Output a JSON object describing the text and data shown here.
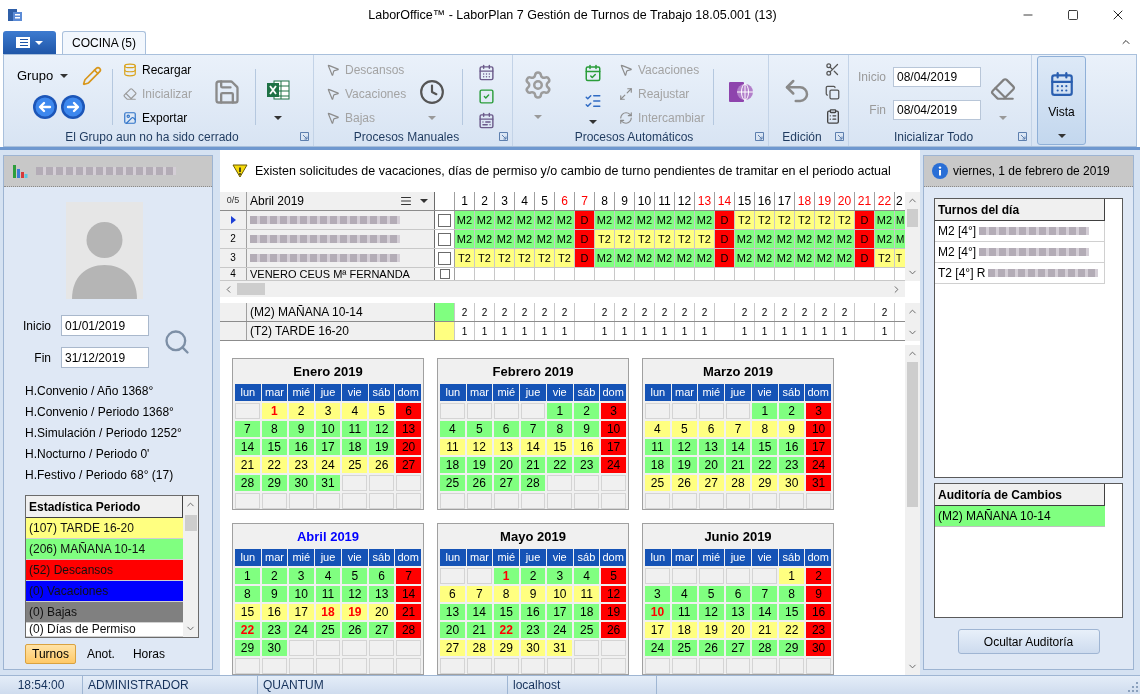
{
  "window": {
    "title": "LaborOffice™ - LaborPlan 7 Gestión de Turnos de Trabajo 18.05.001 (13)"
  },
  "tabs": [
    {
      "label": "COCINA (5)",
      "selected": true
    }
  ],
  "ribbon": {
    "grupo": {
      "label": "Grupo",
      "buttons": [
        {
          "label": "Recargar",
          "disabled": false
        },
        {
          "label": "Inicializar",
          "disabled": true
        },
        {
          "label": "Exportar",
          "disabled": false
        }
      ],
      "caption": "El Grupo aun no ha sido cerrado"
    },
    "manual": {
      "buttons": [
        {
          "label": "Descansos",
          "disabled": true
        },
        {
          "label": "Vacaciones",
          "disabled": true
        },
        {
          "label": "Bajas",
          "disabled": true
        }
      ],
      "caption": "Procesos Manuales"
    },
    "automatic": {
      "buttons": [
        {
          "label": "Vacaciones",
          "disabled": true
        },
        {
          "label": "Reajustar",
          "disabled": true
        },
        {
          "label": "Intercambiar",
          "disabled": true
        }
      ],
      "caption": "Procesos Automáticos"
    },
    "edit": {
      "caption": "Edición"
    },
    "reset_all": {
      "disabled": true,
      "fields": [
        {
          "label": "Inicio",
          "value": "08/04/2019"
        },
        {
          "label": "Fin",
          "value": "08/04/2019"
        }
      ],
      "caption": "Inicializar Todo"
    },
    "view": {
      "label": "Vista",
      "selected": true
    }
  },
  "employee_panel": {
    "dates": [
      {
        "label": "Inicio",
        "value": "01/01/2019"
      },
      {
        "label": "Fin",
        "value": "31/12/2019"
      }
    ],
    "totals": [
      "H.Convenio / Año 1368°",
      "H.Convenio / Periodo 1368°",
      "H.Simulación / Periodo 1252°",
      "H.Nocturno / Periodo 0'",
      "H.Festivo / Periodo 68° (17)"
    ],
    "statistics": {
      "header": "Estadística Periodo",
      "rows": [
        {
          "label": "(107) TARDE 16-20",
          "color": "#ffff80"
        },
        {
          "label": "(206) MAÑANA 10-14",
          "color": "#80ff80"
        },
        {
          "label": "(52) Descansos",
          "color": "#ff0000"
        },
        {
          "label": "(0) Vacaciones",
          "color": "#0000ff"
        },
        {
          "label": "(0) Bajas",
          "color": "#808080"
        },
        {
          "label": "(0) Días de Permiso",
          "color": "#ffffff"
        }
      ]
    },
    "tabs": [
      {
        "label": "Turnos",
        "selected": true
      },
      {
        "label": "Anot.",
        "selected": false
      },
      {
        "label": "Horas",
        "selected": false
      }
    ]
  },
  "notice": "Existen solicitudes de vacaciones, días de permiso y/o cambio de turno pendientes de tramitar en el periodo actual",
  "grid": {
    "counter": "0/5",
    "month": "Abril 2019",
    "days": [
      {
        "label": "1",
        "holiday": false
      },
      {
        "label": "2",
        "holiday": false
      },
      {
        "label": "3",
        "holiday": false
      },
      {
        "label": "4",
        "holiday": false
      },
      {
        "label": "5",
        "holiday": false
      },
      {
        "label": "6",
        "holiday": true
      },
      {
        "label": "7",
        "holiday": true
      },
      {
        "label": "8",
        "holiday": false
      },
      {
        "label": "9",
        "holiday": false
      },
      {
        "label": "10",
        "holiday": false
      },
      {
        "label": "11",
        "holiday": false
      },
      {
        "label": "12",
        "holiday": false
      },
      {
        "label": "13",
        "holiday": true
      },
      {
        "label": "14",
        "holiday": true
      },
      {
        "label": "15",
        "holiday": false
      },
      {
        "label": "16",
        "holiday": false
      },
      {
        "label": "17",
        "holiday": false
      },
      {
        "label": "18",
        "holiday": true
      },
      {
        "label": "19",
        "holiday": true
      },
      {
        "label": "20",
        "holiday": true
      },
      {
        "label": "21",
        "holiday": true
      },
      {
        "label": "22",
        "holiday": true
      },
      {
        "label": "2",
        "holiday": false
      }
    ],
    "rows": [
      {
        "current": true,
        "redacted": true,
        "checked": false,
        "shifts": [
          {
            "code": "M2",
            "kind": "morning"
          },
          {
            "code": "M2",
            "kind": "morning"
          },
          {
            "code": "M2",
            "kind": "morning"
          },
          {
            "code": "M2",
            "kind": "morning"
          },
          {
            "code": "M2",
            "kind": "morning"
          },
          {
            "code": "M2",
            "kind": "morning"
          },
          {
            "code": "D",
            "kind": "rest"
          },
          {
            "code": "M2",
            "kind": "morning"
          },
          {
            "code": "M2",
            "kind": "morning"
          },
          {
            "code": "M2",
            "kind": "morning"
          },
          {
            "code": "M2",
            "kind": "morning"
          },
          {
            "code": "M2",
            "kind": "morning"
          },
          {
            "code": "M2",
            "kind": "morning"
          },
          {
            "code": "D",
            "kind": "rest"
          },
          {
            "code": "T2",
            "kind": "afternoon"
          },
          {
            "code": "T2",
            "kind": "afternoon"
          },
          {
            "code": "T2",
            "kind": "afternoon"
          },
          {
            "code": "T2",
            "kind": "afternoon"
          },
          {
            "code": "T2",
            "kind": "afternoon"
          },
          {
            "code": "T2",
            "kind": "afternoon"
          },
          {
            "code": "D",
            "kind": "rest"
          },
          {
            "code": "M2",
            "kind": "morning"
          },
          {
            "code": "M",
            "kind": "morning"
          }
        ]
      },
      {
        "current": false,
        "number": "2",
        "redacted": true,
        "checked": false,
        "shifts": [
          {
            "code": "M2",
            "kind": "morning"
          },
          {
            "code": "M2",
            "kind": "morning"
          },
          {
            "code": "M2",
            "kind": "morning"
          },
          {
            "code": "M2",
            "kind": "morning"
          },
          {
            "code": "M2",
            "kind": "morning"
          },
          {
            "code": "M2",
            "kind": "morning"
          },
          {
            "code": "D",
            "kind": "rest"
          },
          {
            "code": "T2",
            "kind": "afternoon"
          },
          {
            "code": "T2",
            "kind": "afternoon"
          },
          {
            "code": "T2",
            "kind": "afternoon"
          },
          {
            "code": "T2",
            "kind": "afternoon"
          },
          {
            "code": "T2",
            "kind": "afternoon"
          },
          {
            "code": "T2",
            "kind": "afternoon"
          },
          {
            "code": "D",
            "kind": "rest"
          },
          {
            "code": "M2",
            "kind": "morning"
          },
          {
            "code": "M2",
            "kind": "morning"
          },
          {
            "code": "M2",
            "kind": "morning"
          },
          {
            "code": "M2",
            "kind": "morning"
          },
          {
            "code": "M2",
            "kind": "morning"
          },
          {
            "code": "M2",
            "kind": "morning"
          },
          {
            "code": "D",
            "kind": "rest"
          },
          {
            "code": "M2",
            "kind": "morning"
          },
          {
            "code": "M",
            "kind": "morning"
          }
        ]
      },
      {
        "current": false,
        "number": "3",
        "redacted": true,
        "checked": false,
        "shifts": [
          {
            "code": "T2",
            "kind": "afternoon"
          },
          {
            "code": "T2",
            "kind": "afternoon"
          },
          {
            "code": "T2",
            "kind": "afternoon"
          },
          {
            "code": "T2",
            "kind": "afternoon"
          },
          {
            "code": "T2",
            "kind": "afternoon"
          },
          {
            "code": "T2",
            "kind": "afternoon"
          },
          {
            "code": "D",
            "kind": "rest"
          },
          {
            "code": "M2",
            "kind": "morning"
          },
          {
            "code": "M2",
            "kind": "morning"
          },
          {
            "code": "M2",
            "kind": "morning"
          },
          {
            "code": "M2",
            "kind": "morning"
          },
          {
            "code": "M2",
            "kind": "morning"
          },
          {
            "code": "M2",
            "kind": "morning"
          },
          {
            "code": "D",
            "kind": "rest"
          },
          {
            "code": "M2",
            "kind": "morning"
          },
          {
            "code": "M2",
            "kind": "morning"
          },
          {
            "code": "M2",
            "kind": "morning"
          },
          {
            "code": "M2",
            "kind": "morning"
          },
          {
            "code": "M2",
            "kind": "morning"
          },
          {
            "code": "M2",
            "kind": "morning"
          },
          {
            "code": "D",
            "kind": "rest"
          },
          {
            "code": "T2",
            "kind": "afternoon"
          },
          {
            "code": "T",
            "kind": "afternoon"
          }
        ]
      },
      {
        "current": false,
        "number": "4",
        "redacted": false,
        "name": "VENERO CEUS Mª FERNANDA",
        "checked": false,
        "shifts": []
      }
    ]
  },
  "shift_totals": [
    {
      "label": "(M2) MAÑANA 10-14",
      "color": "#80ff80",
      "counts": [
        {
          "kind": "count",
          "value": "2"
        },
        {
          "kind": "count",
          "value": "2"
        },
        {
          "kind": "count",
          "value": "2"
        },
        {
          "kind": "count",
          "value": "2"
        },
        {
          "kind": "count",
          "value": "2"
        },
        {
          "kind": "count",
          "value": "2"
        },
        {
          "kind": "empty"
        },
        {
          "kind": "count",
          "value": "2"
        },
        {
          "kind": "count",
          "value": "2"
        },
        {
          "kind": "count",
          "value": "2"
        },
        {
          "kind": "count",
          "value": "2"
        },
        {
          "kind": "count",
          "value": "2"
        },
        {
          "kind": "count",
          "value": "2"
        },
        {
          "kind": "empty"
        },
        {
          "kind": "count",
          "value": "2"
        },
        {
          "kind": "count",
          "value": "2"
        },
        {
          "kind": "count",
          "value": "2"
        },
        {
          "kind": "count",
          "value": "2"
        },
        {
          "kind": "count",
          "value": "2"
        },
        {
          "kind": "count",
          "value": "2"
        },
        {
          "kind": "empty"
        },
        {
          "kind": "count",
          "value": "2"
        }
      ]
    },
    {
      "label": "(T2) TARDE 16-20",
      "color": "#ffff80",
      "counts": [
        {
          "kind": "count",
          "value": "1"
        },
        {
          "kind": "count",
          "value": "1"
        },
        {
          "kind": "count",
          "value": "1"
        },
        {
          "kind": "count",
          "value": "1"
        },
        {
          "kind": "count",
          "value": "1"
        },
        {
          "kind": "count",
          "value": "1"
        },
        {
          "kind": "empty"
        },
        {
          "kind": "count",
          "value": "1"
        },
        {
          "kind": "count",
          "value": "1"
        },
        {
          "kind": "count",
          "value": "1"
        },
        {
          "kind": "count",
          "value": "1"
        },
        {
          "kind": "count",
          "value": "1"
        },
        {
          "kind": "count",
          "value": "1"
        },
        {
          "kind": "empty"
        },
        {
          "kind": "count",
          "value": "1"
        },
        {
          "kind": "count",
          "value": "1"
        },
        {
          "kind": "count",
          "value": "1"
        },
        {
          "kind": "count",
          "value": "1"
        },
        {
          "kind": "count",
          "value": "1"
        },
        {
          "kind": "count",
          "value": "1"
        },
        {
          "kind": "empty"
        },
        {
          "kind": "count",
          "value": "1"
        }
      ]
    }
  ],
  "calendars": [
    {
      "title": "Enero 2019",
      "selected": false,
      "weekdays": [
        "lun",
        "mar",
        "mié",
        "jue",
        "vie",
        "sáb",
        "dom"
      ],
      "weeks": [
        [
          {
            "kind": "blank"
          },
          {
            "day": "1",
            "kind": "afternoon",
            "holiday": true
          },
          {
            "day": "2",
            "kind": "afternoon",
            "holiday": false
          },
          {
            "day": "3",
            "kind": "afternoon",
            "holiday": false
          },
          {
            "day": "4",
            "kind": "afternoon",
            "holiday": false
          },
          {
            "day": "5",
            "kind": "afternoon",
            "holiday": false
          },
          {
            "day": "6",
            "kind": "rest",
            "holiday": false
          }
        ],
        [
          {
            "day": "7",
            "kind": "morning",
            "holiday": false
          },
          {
            "day": "8",
            "kind": "morning",
            "holiday": false
          },
          {
            "day": "9",
            "kind": "morning",
            "holiday": false
          },
          {
            "day": "10",
            "kind": "morning",
            "holiday": false
          },
          {
            "day": "11",
            "kind": "morning",
            "holiday": false
          },
          {
            "day": "12",
            "kind": "morning",
            "holiday": false
          },
          {
            "day": "13",
            "kind": "rest",
            "holiday": false
          }
        ],
        [
          {
            "day": "14",
            "kind": "morning",
            "holiday": false
          },
          {
            "day": "15",
            "kind": "morning",
            "holiday": false
          },
          {
            "day": "16",
            "kind": "morning",
            "holiday": false
          },
          {
            "day": "17",
            "kind": "morning",
            "holiday": false
          },
          {
            "day": "18",
            "kind": "morning",
            "holiday": false
          },
          {
            "day": "19",
            "kind": "morning",
            "holiday": false
          },
          {
            "day": "20",
            "kind": "rest",
            "holiday": false
          }
        ],
        [
          {
            "day": "21",
            "kind": "afternoon",
            "holiday": false
          },
          {
            "day": "22",
            "kind": "afternoon",
            "holiday": false
          },
          {
            "day": "23",
            "kind": "afternoon",
            "holiday": false
          },
          {
            "day": "24",
            "kind": "afternoon",
            "holiday": false
          },
          {
            "day": "25",
            "kind": "afternoon",
            "holiday": false
          },
          {
            "day": "26",
            "kind": "afternoon",
            "holiday": false
          },
          {
            "day": "27",
            "kind": "rest",
            "holiday": false
          }
        ],
        [
          {
            "day": "28",
            "kind": "morning",
            "holiday": false
          },
          {
            "day": "29",
            "kind": "morning",
            "holiday": false
          },
          {
            "day": "30",
            "kind": "morning",
            "holiday": false
          },
          {
            "day": "31",
            "kind": "morning",
            "holiday": false
          }
        ]
      ]
    },
    {
      "title": "Febrero 2019",
      "selected": false,
      "weekdays": [
        "lun",
        "mar",
        "mié",
        "jue",
        "vie",
        "sáb",
        "dom"
      ],
      "weeks": [
        [
          {
            "kind": "blank"
          },
          {
            "kind": "blank"
          },
          {
            "kind": "blank"
          },
          {
            "kind": "blank"
          },
          {
            "day": "1",
            "kind": "morning",
            "holiday": false
          },
          {
            "day": "2",
            "kind": "morning",
            "holiday": false
          },
          {
            "day": "3",
            "kind": "rest",
            "holiday": false
          }
        ],
        [
          {
            "day": "4",
            "kind": "morning",
            "holiday": false
          },
          {
            "day": "5",
            "kind": "morning",
            "holiday": false
          },
          {
            "day": "6",
            "kind": "morning",
            "holiday": false
          },
          {
            "day": "7",
            "kind": "morning",
            "holiday": false
          },
          {
            "day": "8",
            "kind": "morning",
            "holiday": false
          },
          {
            "day": "9",
            "kind": "morning",
            "holiday": false
          },
          {
            "day": "10",
            "kind": "rest",
            "holiday": false
          }
        ],
        [
          {
            "day": "11",
            "kind": "afternoon",
            "holiday": false
          },
          {
            "day": "12",
            "kind": "afternoon",
            "holiday": false
          },
          {
            "day": "13",
            "kind": "afternoon",
            "holiday": false
          },
          {
            "day": "14",
            "kind": "afternoon",
            "holiday": false
          },
          {
            "day": "15",
            "kind": "afternoon",
            "holiday": false
          },
          {
            "day": "16",
            "kind": "afternoon",
            "holiday": false
          },
          {
            "day": "17",
            "kind": "rest",
            "holiday": false
          }
        ],
        [
          {
            "day": "18",
            "kind": "morning",
            "holiday": false
          },
          {
            "day": "19",
            "kind": "morning",
            "holiday": false
          },
          {
            "day": "20",
            "kind": "morning",
            "holiday": false
          },
          {
            "day": "21",
            "kind": "morning",
            "holiday": false
          },
          {
            "day": "22",
            "kind": "morning",
            "holiday": false
          },
          {
            "day": "23",
            "kind": "morning",
            "holiday": false
          },
          {
            "day": "24",
            "kind": "rest",
            "holiday": false
          }
        ],
        [
          {
            "day": "25",
            "kind": "morning",
            "holiday": false
          },
          {
            "day": "26",
            "kind": "morning",
            "holiday": false
          },
          {
            "day": "27",
            "kind": "morning",
            "holiday": false
          },
          {
            "day": "28",
            "kind": "morning",
            "holiday": false
          }
        ]
      ]
    },
    {
      "title": "Marzo 2019",
      "selected": false,
      "weekdays": [
        "lun",
        "mar",
        "mié",
        "jue",
        "vie",
        "sáb",
        "dom"
      ],
      "weeks": [
        [
          {
            "kind": "blank"
          },
          {
            "kind": "blank"
          },
          {
            "kind": "blank"
          },
          {
            "kind": "blank"
          },
          {
            "day": "1",
            "kind": "morning",
            "holiday": false
          },
          {
            "day": "2",
            "kind": "morning",
            "holiday": false
          },
          {
            "day": "3",
            "kind": "rest",
            "holiday": false
          }
        ],
        [
          {
            "day": "4",
            "kind": "afternoon",
            "holiday": false
          },
          {
            "day": "5",
            "kind": "afternoon",
            "holiday": false
          },
          {
            "day": "6",
            "kind": "afternoon",
            "holiday": false
          },
          {
            "day": "7",
            "kind": "afternoon",
            "holiday": false
          },
          {
            "day": "8",
            "kind": "afternoon",
            "holiday": false
          },
          {
            "day": "9",
            "kind": "afternoon",
            "holiday": false
          },
          {
            "day": "10",
            "kind": "rest",
            "holiday": false
          }
        ],
        [
          {
            "day": "11",
            "kind": "morning",
            "holiday": false
          },
          {
            "day": "12",
            "kind": "morning",
            "holiday": false
          },
          {
            "day": "13",
            "kind": "morning",
            "holiday": false
          },
          {
            "day": "14",
            "kind": "morning",
            "holiday": false
          },
          {
            "day": "15",
            "kind": "morning",
            "holiday": false
          },
          {
            "day": "16",
            "kind": "morning",
            "holiday": false
          },
          {
            "day": "17",
            "kind": "rest",
            "holiday": false
          }
        ],
        [
          {
            "day": "18",
            "kind": "morning",
            "holiday": false
          },
          {
            "day": "19",
            "kind": "morning",
            "holiday": false
          },
          {
            "day": "20",
            "kind": "morning",
            "holiday": false
          },
          {
            "day": "21",
            "kind": "morning",
            "holiday": false
          },
          {
            "day": "22",
            "kind": "morning",
            "holiday": false
          },
          {
            "day": "23",
            "kind": "morning",
            "holiday": false
          },
          {
            "day": "24",
            "kind": "rest",
            "holiday": false
          }
        ],
        [
          {
            "day": "25",
            "kind": "afternoon",
            "holiday": false
          },
          {
            "day": "26",
            "kind": "afternoon",
            "holiday": false
          },
          {
            "day": "27",
            "kind": "afternoon",
            "holiday": false
          },
          {
            "day": "28",
            "kind": "afternoon",
            "holiday": false
          },
          {
            "day": "29",
            "kind": "afternoon",
            "holiday": false
          },
          {
            "day": "30",
            "kind": "afternoon",
            "holiday": false
          },
          {
            "day": "31",
            "kind": "rest",
            "holiday": false
          }
        ]
      ]
    },
    {
      "title": "Abril 2019",
      "selected": true,
      "weekdays": [
        "lun",
        "mar",
        "mié",
        "jue",
        "vie",
        "sáb",
        "dom"
      ],
      "weeks": [
        [
          {
            "day": "1",
            "kind": "morning",
            "holiday": false
          },
          {
            "day": "2",
            "kind": "morning",
            "holiday": false
          },
          {
            "day": "3",
            "kind": "morning",
            "holiday": false
          },
          {
            "day": "4",
            "kind": "morning",
            "holiday": false
          },
          {
            "day": "5",
            "kind": "morning",
            "holiday": false
          },
          {
            "day": "6",
            "kind": "morning",
            "holiday": false
          },
          {
            "day": "7",
            "kind": "rest",
            "holiday": false
          }
        ],
        [
          {
            "day": "8",
            "kind": "morning",
            "holiday": false
          },
          {
            "day": "9",
            "kind": "morning",
            "holiday": false
          },
          {
            "day": "10",
            "kind": "morning",
            "holiday": false
          },
          {
            "day": "11",
            "kind": "morning",
            "holiday": false
          },
          {
            "day": "12",
            "kind": "morning",
            "holiday": false
          },
          {
            "day": "13",
            "kind": "morning",
            "holiday": false
          },
          {
            "day": "14",
            "kind": "rest",
            "holiday": false
          }
        ],
        [
          {
            "day": "15",
            "kind": "afternoon",
            "holiday": false
          },
          {
            "day": "16",
            "kind": "afternoon",
            "holiday": false
          },
          {
            "day": "17",
            "kind": "afternoon",
            "holiday": false
          },
          {
            "day": "18",
            "kind": "afternoon",
            "holiday": true
          },
          {
            "day": "19",
            "kind": "afternoon",
            "holiday": true
          },
          {
            "day": "20",
            "kind": "afternoon",
            "holiday": false
          },
          {
            "day": "21",
            "kind": "rest",
            "holiday": false
          }
        ],
        [
          {
            "day": "22",
            "kind": "morning",
            "holiday": true
          },
          {
            "day": "23",
            "kind": "morning",
            "holiday": false
          },
          {
            "day": "24",
            "kind": "morning",
            "holiday": false
          },
          {
            "day": "25",
            "kind": "morning",
            "holiday": false
          },
          {
            "day": "26",
            "kind": "morning",
            "holiday": false
          },
          {
            "day": "27",
            "kind": "morning",
            "holiday": false
          },
          {
            "day": "28",
            "kind": "rest",
            "holiday": false
          }
        ],
        [
          {
            "day": "29",
            "kind": "morning",
            "holiday": false
          },
          {
            "day": "30",
            "kind": "morning",
            "holiday": false
          }
        ]
      ]
    },
    {
      "title": "Mayo 2019",
      "selected": false,
      "weekdays": [
        "lun",
        "mar",
        "mié",
        "jue",
        "vie",
        "sáb",
        "dom"
      ],
      "weeks": [
        [
          {
            "kind": "blank"
          },
          {
            "kind": "blank"
          },
          {
            "day": "1",
            "kind": "morning",
            "holiday": true
          },
          {
            "day": "2",
            "kind": "morning",
            "holiday": false
          },
          {
            "day": "3",
            "kind": "morning",
            "holiday": false
          },
          {
            "day": "4",
            "kind": "morning",
            "holiday": false
          },
          {
            "day": "5",
            "kind": "rest",
            "holiday": false
          }
        ],
        [
          {
            "day": "6",
            "kind": "afternoon",
            "holiday": false
          },
          {
            "day": "7",
            "kind": "afternoon",
            "holiday": false
          },
          {
            "day": "8",
            "kind": "afternoon",
            "holiday": false
          },
          {
            "day": "9",
            "kind": "afternoon",
            "holiday": false
          },
          {
            "day": "10",
            "kind": "afternoon",
            "holiday": false
          },
          {
            "day": "11",
            "kind": "afternoon",
            "holiday": false
          },
          {
            "day": "12",
            "kind": "rest",
            "holiday": false
          }
        ],
        [
          {
            "day": "13",
            "kind": "morning",
            "holiday": false
          },
          {
            "day": "14",
            "kind": "morning",
            "holiday": false
          },
          {
            "day": "15",
            "kind": "morning",
            "holiday": false
          },
          {
            "day": "16",
            "kind": "morning",
            "holiday": false
          },
          {
            "day": "17",
            "kind": "morning",
            "holiday": false
          },
          {
            "day": "18",
            "kind": "morning",
            "holiday": false
          },
          {
            "day": "19",
            "kind": "rest",
            "holiday": false
          }
        ],
        [
          {
            "day": "20",
            "kind": "morning",
            "holiday": false
          },
          {
            "day": "21",
            "kind": "morning",
            "holiday": false
          },
          {
            "day": "22",
            "kind": "morning",
            "holiday": true
          },
          {
            "day": "23",
            "kind": "morning",
            "holiday": false
          },
          {
            "day": "24",
            "kind": "morning",
            "holiday": false
          },
          {
            "day": "25",
            "kind": "morning",
            "holiday": false
          },
          {
            "day": "26",
            "kind": "rest",
            "holiday": false
          }
        ],
        [
          {
            "day": "27",
            "kind": "afternoon",
            "holiday": false
          },
          {
            "day": "28",
            "kind": "afternoon",
            "holiday": false
          },
          {
            "day": "29",
            "kind": "afternoon",
            "holiday": false
          },
          {
            "day": "30",
            "kind": "afternoon",
            "holiday": false
          },
          {
            "day": "31",
            "kind": "afternoon",
            "holiday": false
          }
        ]
      ]
    },
    {
      "title": "Junio 2019",
      "selected": false,
      "weekdays": [
        "lun",
        "mar",
        "mié",
        "jue",
        "vie",
        "sáb",
        "dom"
      ],
      "weeks": [
        [
          {
            "kind": "blank"
          },
          {
            "kind": "blank"
          },
          {
            "kind": "blank"
          },
          {
            "kind": "blank"
          },
          {
            "kind": "blank"
          },
          {
            "day": "1",
            "kind": "afternoon",
            "holiday": false
          },
          {
            "day": "2",
            "kind": "rest",
            "holiday": false
          }
        ],
        [
          {
            "day": "3",
            "kind": "morning",
            "holiday": false
          },
          {
            "day": "4",
            "kind": "morning",
            "holiday": false
          },
          {
            "day": "5",
            "kind": "morning",
            "holiday": false
          },
          {
            "day": "6",
            "kind": "morning",
            "holiday": false
          },
          {
            "day": "7",
            "kind": "morning",
            "holiday": false
          },
          {
            "day": "8",
            "kind": "morning",
            "holiday": false
          },
          {
            "day": "9",
            "kind": "rest",
            "holiday": false
          }
        ],
        [
          {
            "day": "10",
            "kind": "morning",
            "holiday": true
          },
          {
            "day": "11",
            "kind": "morning",
            "holiday": false
          },
          {
            "day": "12",
            "kind": "morning",
            "holiday": false
          },
          {
            "day": "13",
            "kind": "morning",
            "holiday": false
          },
          {
            "day": "14",
            "kind": "morning",
            "holiday": false
          },
          {
            "day": "15",
            "kind": "morning",
            "holiday": false
          },
          {
            "day": "16",
            "kind": "rest",
            "holiday": false
          }
        ],
        [
          {
            "day": "17",
            "kind": "afternoon",
            "holiday": false
          },
          {
            "day": "18",
            "kind": "afternoon",
            "holiday": false
          },
          {
            "day": "19",
            "kind": "afternoon",
            "holiday": false
          },
          {
            "day": "20",
            "kind": "afternoon",
            "holiday": false
          },
          {
            "day": "21",
            "kind": "afternoon",
            "holiday": false
          },
          {
            "day": "22",
            "kind": "afternoon",
            "holiday": false
          },
          {
            "day": "23",
            "kind": "rest",
            "holiday": false
          }
        ],
        [
          {
            "day": "24",
            "kind": "morning",
            "holiday": false
          },
          {
            "day": "25",
            "kind": "morning",
            "holiday": false
          },
          {
            "day": "26",
            "kind": "morning",
            "holiday": false
          },
          {
            "day": "27",
            "kind": "morning",
            "holiday": false
          },
          {
            "day": "28",
            "kind": "morning",
            "holiday": false
          },
          {
            "day": "29",
            "kind": "morning",
            "holiday": false
          },
          {
            "day": "30",
            "kind": "rest",
            "holiday": false
          }
        ]
      ]
    }
  ],
  "day_panel": {
    "date": "viernes, 1 de febrero de 2019",
    "shifts": {
      "header": "Turnos del día",
      "rows": [
        "M2 [4°]",
        "M2 [4°]",
        "T2 [4°] R"
      ]
    },
    "audit": {
      "header": "Auditoría de Cambios",
      "rows": [
        {
          "label": "(M2) MAÑANA 10-14",
          "color": "#80ff80"
        }
      ]
    },
    "button": "Ocultar Auditoría"
  },
  "status_bar": [
    "18:54:00",
    "ADMINISTRADOR",
    "QUANTUM",
    "localhost"
  ]
}
